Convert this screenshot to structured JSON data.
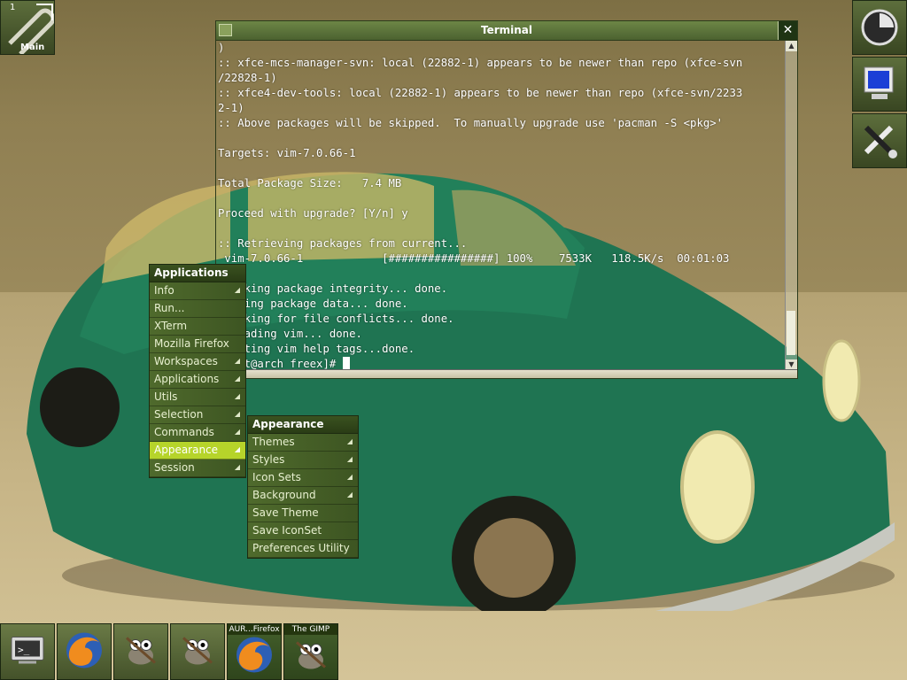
{
  "workspace": {
    "number": "1",
    "name": "Main"
  },
  "terminal": {
    "title": "Terminal",
    "close_glyph": "✕",
    "lines": [
      ")",
      ":: xfce-mcs-manager-svn: local (22882-1) appears to be newer than repo (xfce-svn",
      "/22828-1)",
      ":: xfce4-dev-tools: local (22882-1) appears to be newer than repo (xfce-svn/2233",
      "2-1)",
      ":: Above packages will be skipped.  To manually upgrade use 'pacman -S <pkg>'",
      "",
      "Targets: vim-7.0.66-1",
      "",
      "Total Package Size:   7.4 MB",
      "",
      "Proceed with upgrade? [Y/n] y",
      "",
      ":: Retrieving packages from current...",
      " vim-7.0.66-1            [################] 100%    7533K   118.5K/s  00:01:03",
      "",
      "checking package integrity... done.",
      "loading package data... done.",
      "checking for file conflicts... done.",
      "upgrading vim... done.",
      "Updating vim help tags...done."
    ],
    "prompt": "[root@arch freex]# "
  },
  "applications_menu": {
    "title": "Applications",
    "items": [
      {
        "label": "Info",
        "submenu": true
      },
      {
        "label": "Run...",
        "submenu": false
      },
      {
        "label": "XTerm",
        "submenu": false
      },
      {
        "label": "Mozilla Firefox",
        "submenu": false
      },
      {
        "label": "Workspaces",
        "submenu": true
      },
      {
        "label": "Applications",
        "submenu": true
      },
      {
        "label": "Utils",
        "submenu": true
      },
      {
        "label": "Selection",
        "submenu": true
      },
      {
        "label": "Commands",
        "submenu": true
      },
      {
        "label": "Appearance",
        "submenu": true,
        "selected": true
      },
      {
        "label": "Session",
        "submenu": true
      }
    ]
  },
  "appearance_menu": {
    "title": "Appearance",
    "items": [
      {
        "label": "Themes",
        "submenu": true
      },
      {
        "label": "Styles",
        "submenu": true
      },
      {
        "label": "Icon Sets",
        "submenu": true
      },
      {
        "label": "Background",
        "submenu": true
      },
      {
        "label": "Save Theme",
        "submenu": false
      },
      {
        "label": "Save IconSet",
        "submenu": false
      },
      {
        "label": "Preferences Utility",
        "submenu": false
      }
    ]
  },
  "taskbar": [
    {
      "icon": "terminal-icon",
      "label": ""
    },
    {
      "icon": "firefox-icon",
      "label": ""
    },
    {
      "icon": "gimp-icon",
      "label": ""
    },
    {
      "icon": "gimp-icon",
      "label": ""
    },
    {
      "icon": "firefox-icon",
      "label": "AUR...Firefox"
    },
    {
      "icon": "gimp-icon",
      "label": "The GIMP"
    }
  ],
  "dock_right": [
    {
      "icon": "system-monitor-icon"
    },
    {
      "icon": "display-monitor-icon"
    },
    {
      "icon": "settings-tools-icon"
    }
  ],
  "colors": {
    "accent": "#b6d42a",
    "menu_bg": "#4f6a2c",
    "titlebar": "#5b7739"
  }
}
